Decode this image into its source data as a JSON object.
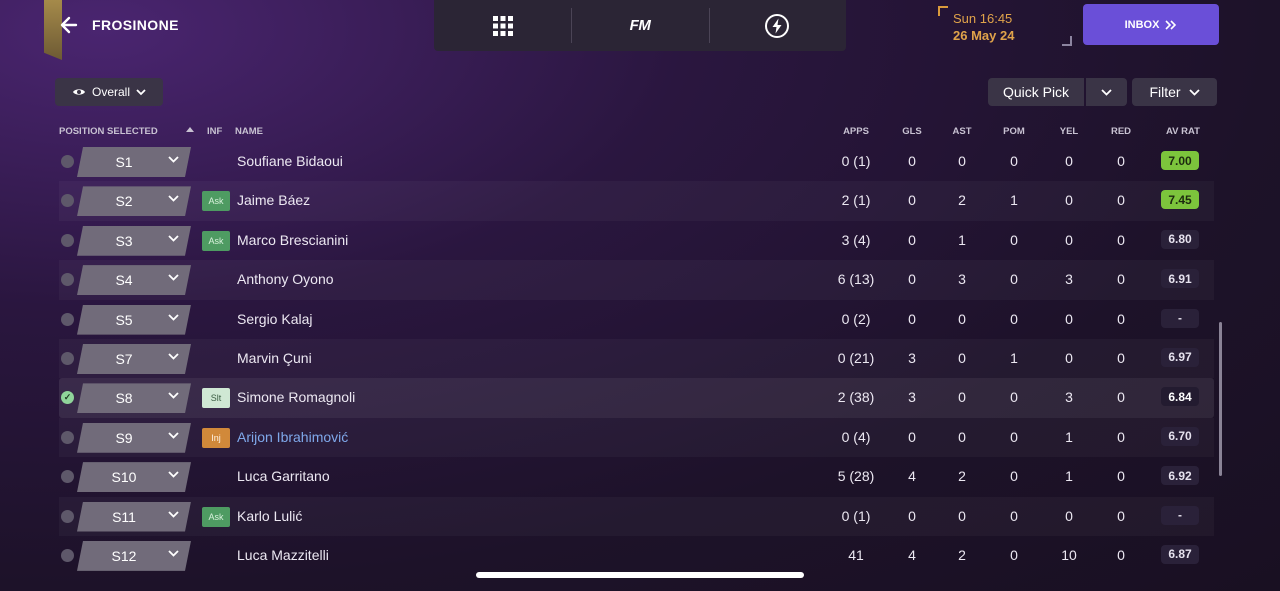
{
  "header": {
    "club": "FROSINONE",
    "time": "Sun 16:45",
    "date": "26 May 24",
    "inbox_label": "INBOX",
    "fm_label": "FM"
  },
  "toolbar": {
    "view_label": "Overall",
    "quick_pick_label": "Quick Pick",
    "filter_label": "Filter"
  },
  "columns": {
    "position": "POSITION SELECTED",
    "inf": "INF",
    "name": "NAME",
    "apps": "APPS",
    "gls": "GLS",
    "ast": "AST",
    "pom": "POM",
    "yel": "YEL",
    "red": "RED",
    "avrat": "AV RAT"
  },
  "rows": [
    {
      "pos": "S1",
      "inf": "",
      "name": "Soufiane Bidaoui",
      "apps": "0 (1)",
      "gls": "0",
      "ast": "0",
      "pom": "0",
      "yel": "0",
      "red": "0",
      "rat": "7.00",
      "rat_style": "good",
      "selected": false,
      "injured": false
    },
    {
      "pos": "S2",
      "inf": "Ask",
      "name": "Jaime Báez",
      "apps": "2 (1)",
      "gls": "0",
      "ast": "2",
      "pom": "1",
      "yel": "0",
      "red": "0",
      "rat": "7.45",
      "rat_style": "good",
      "selected": false,
      "injured": false
    },
    {
      "pos": "S3",
      "inf": "Ask",
      "name": "Marco Brescianini",
      "apps": "3 (4)",
      "gls": "0",
      "ast": "1",
      "pom": "0",
      "yel": "0",
      "red": "0",
      "rat": "6.80",
      "rat_style": "mid",
      "selected": false,
      "injured": false
    },
    {
      "pos": "S4",
      "inf": "",
      "name": "Anthony Oyono",
      "apps": "6 (13)",
      "gls": "0",
      "ast": "3",
      "pom": "0",
      "yel": "3",
      "red": "0",
      "rat": "6.91",
      "rat_style": "mid",
      "selected": false,
      "injured": false
    },
    {
      "pos": "S5",
      "inf": "",
      "name": "Sergio Kalaj",
      "apps": "0 (2)",
      "gls": "0",
      "ast": "0",
      "pom": "0",
      "yel": "0",
      "red": "0",
      "rat": "-",
      "rat_style": "mid",
      "selected": false,
      "injured": false
    },
    {
      "pos": "S7",
      "inf": "",
      "name": "Marvin Çuni",
      "apps": "0 (21)",
      "gls": "3",
      "ast": "0",
      "pom": "1",
      "yel": "0",
      "red": "0",
      "rat": "6.97",
      "rat_style": "mid",
      "selected": false,
      "injured": false
    },
    {
      "pos": "S8",
      "inf": "Slt",
      "name": "Simone Romagnoli",
      "apps": "2 (38)",
      "gls": "3",
      "ast": "0",
      "pom": "0",
      "yel": "3",
      "red": "0",
      "rat": "6.84",
      "rat_style": "sel",
      "selected": true,
      "injured": false
    },
    {
      "pos": "S9",
      "inf": "Inj",
      "name": "Arijon Ibrahimović",
      "apps": "0 (4)",
      "gls": "0",
      "ast": "0",
      "pom": "0",
      "yel": "1",
      "red": "0",
      "rat": "6.70",
      "rat_style": "mid",
      "selected": false,
      "injured": true
    },
    {
      "pos": "S10",
      "inf": "",
      "name": "Luca Garritano",
      "apps": "5 (28)",
      "gls": "4",
      "ast": "2",
      "pom": "0",
      "yel": "1",
      "red": "0",
      "rat": "6.92",
      "rat_style": "mid",
      "selected": false,
      "injured": false
    },
    {
      "pos": "S11",
      "inf": "Ask",
      "name": "Karlo Lulić",
      "apps": "0 (1)",
      "gls": "0",
      "ast": "0",
      "pom": "0",
      "yel": "0",
      "red": "0",
      "rat": "-",
      "rat_style": "mid",
      "selected": false,
      "injured": false
    },
    {
      "pos": "S12",
      "inf": "",
      "name": "Luca Mazzitelli",
      "apps": "41",
      "gls": "4",
      "ast": "2",
      "pom": "0",
      "yel": "10",
      "red": "0",
      "rat": "6.87",
      "rat_style": "mid",
      "selected": false,
      "injured": false
    }
  ]
}
